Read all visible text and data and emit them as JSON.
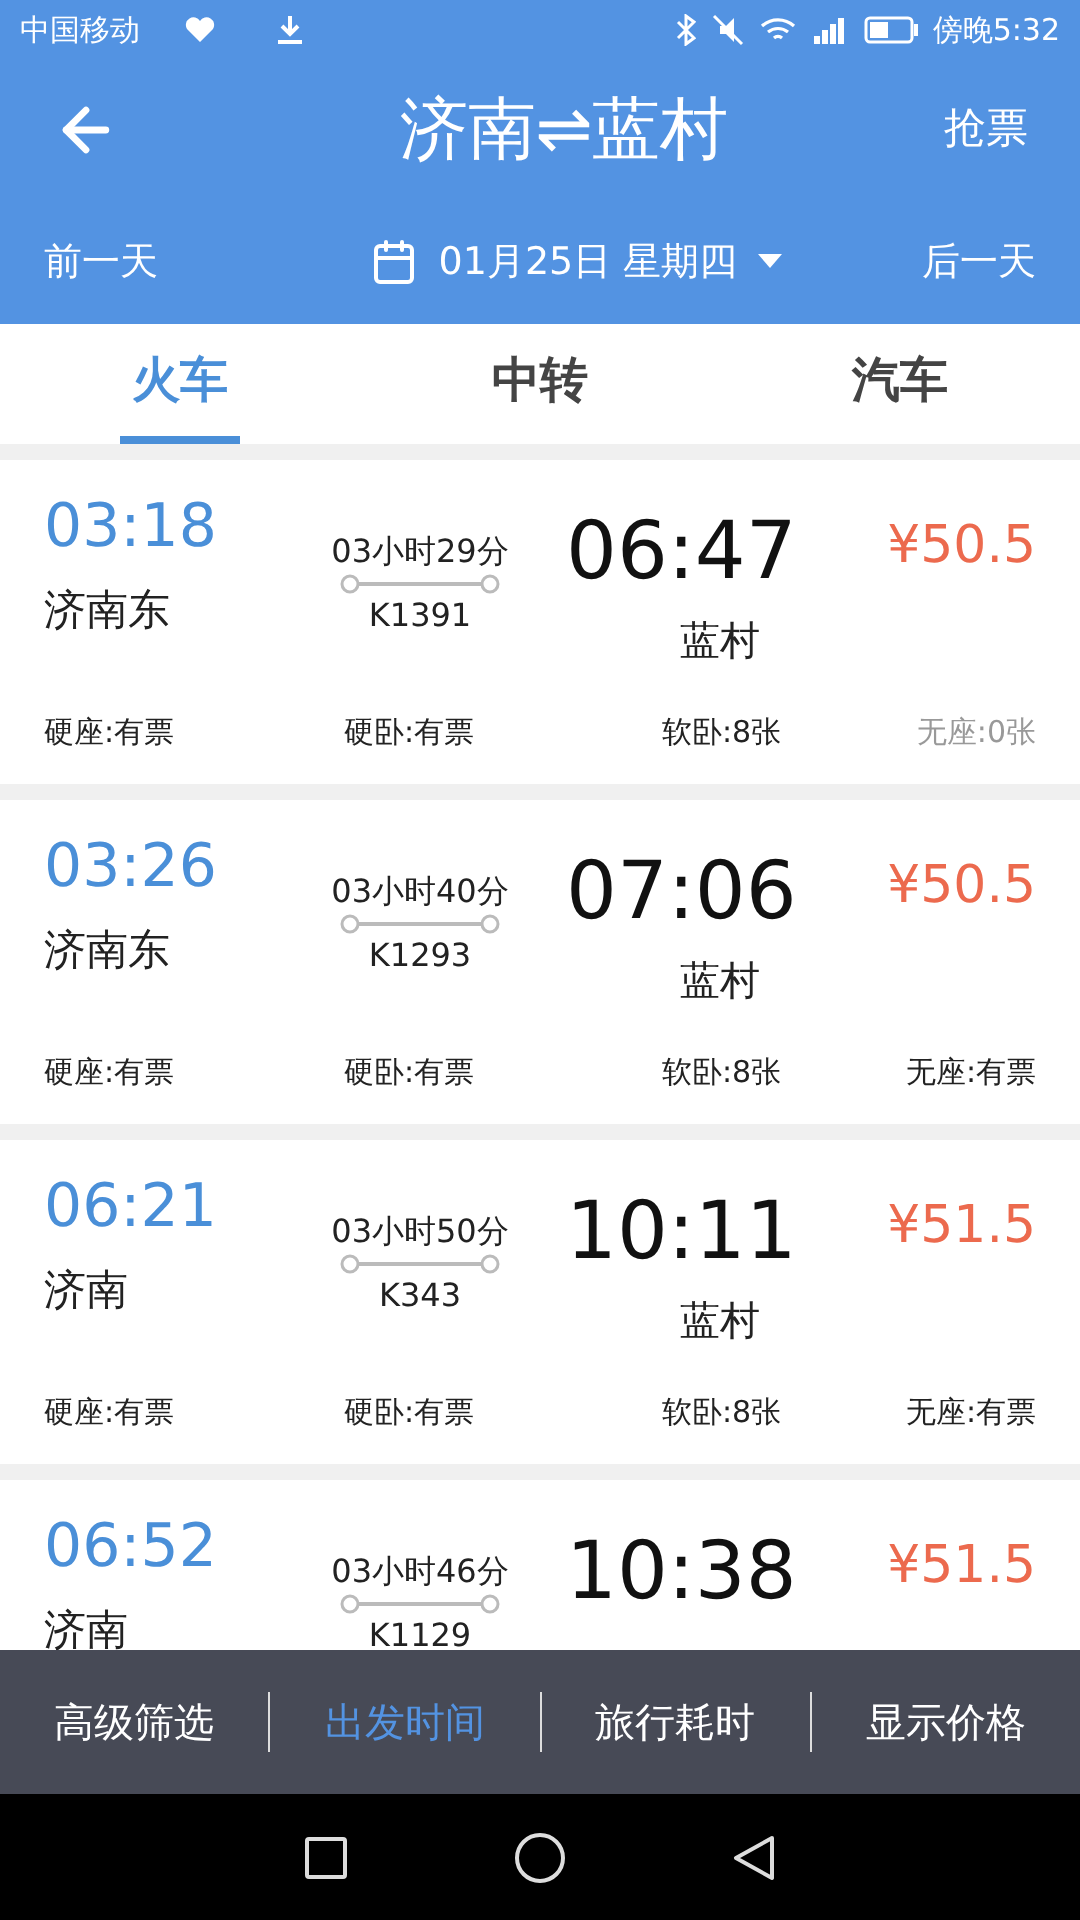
{
  "status_bar": {
    "carrier": "中国移动",
    "time": "傍晚5:32"
  },
  "header": {
    "title": "济南⇌蓝村",
    "action": "抢票",
    "prev_day": "前一天",
    "date": "01月25日 星期四",
    "next_day": "后一天"
  },
  "tabs": [
    {
      "label": "火车",
      "selected": true
    },
    {
      "label": "中转",
      "selected": false
    },
    {
      "label": "汽车",
      "selected": false
    }
  ],
  "trains": [
    {
      "depart_time": "03:18",
      "depart_station": "济南东",
      "duration": "03小时29分",
      "train_no": "K1391",
      "arrive_time": "06:47",
      "arrive_station": "蓝村",
      "price": "¥50.5",
      "seats": [
        {
          "text": "硬座:有票",
          "available": true
        },
        {
          "text": "硬卧:有票",
          "available": true
        },
        {
          "text": "软卧:8张",
          "available": true
        },
        {
          "text": "无座:0张",
          "available": false
        }
      ]
    },
    {
      "depart_time": "03:26",
      "depart_station": "济南东",
      "duration": "03小时40分",
      "train_no": "K1293",
      "arrive_time": "07:06",
      "arrive_station": "蓝村",
      "price": "¥50.5",
      "seats": [
        {
          "text": "硬座:有票",
          "available": true
        },
        {
          "text": "硬卧:有票",
          "available": true
        },
        {
          "text": "软卧:8张",
          "available": true
        },
        {
          "text": "无座:有票",
          "available": true
        }
      ]
    },
    {
      "depart_time": "06:21",
      "depart_station": "济南",
      "duration": "03小时50分",
      "train_no": "K343",
      "arrive_time": "10:11",
      "arrive_station": "蓝村",
      "price": "¥51.5",
      "seats": [
        {
          "text": "硬座:有票",
          "available": true
        },
        {
          "text": "硬卧:有票",
          "available": true
        },
        {
          "text": "软卧:8张",
          "available": true
        },
        {
          "text": "无座:有票",
          "available": true
        }
      ]
    },
    {
      "depart_time": "06:52",
      "depart_station": "济南",
      "duration": "03小时46分",
      "train_no": "K1129",
      "arrive_time": "10:38",
      "price": "¥51.5"
    }
  ],
  "filters": [
    {
      "label": "高级筛选",
      "selected": false
    },
    {
      "label": "出发时间",
      "selected": true
    },
    {
      "label": "旅行耗时",
      "selected": false
    },
    {
      "label": "显示价格",
      "selected": false
    }
  ]
}
